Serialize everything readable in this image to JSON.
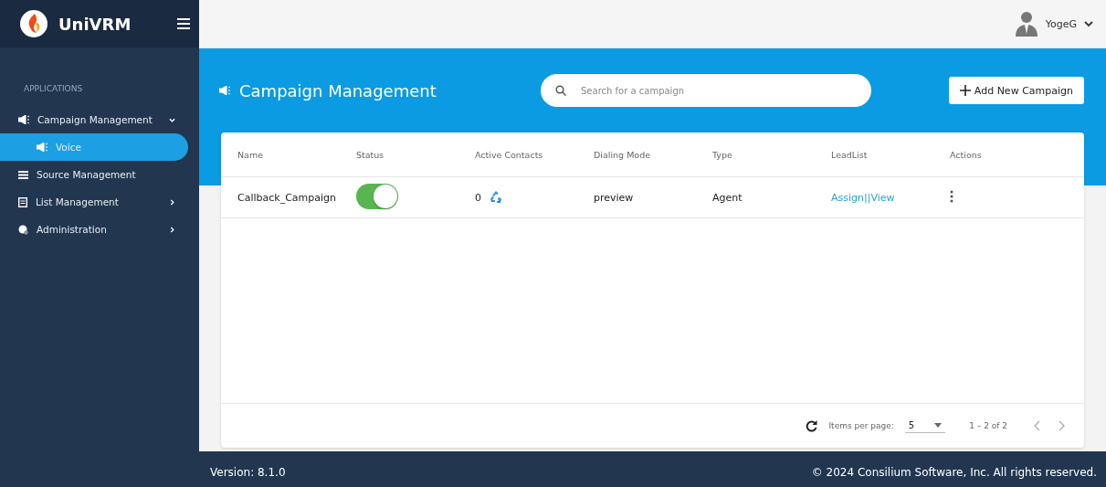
{
  "app": {
    "name": "UniVRM"
  },
  "user": {
    "name": "YogeG"
  },
  "sidebar": {
    "section": "APPLICATIONS",
    "items": [
      {
        "label": "Campaign Management",
        "expanded": true,
        "selected": false,
        "children": [
          {
            "label": "Voice",
            "selected": true
          }
        ]
      },
      {
        "label": "Source Management",
        "selected": false
      },
      {
        "label": "List Management",
        "expanded": false,
        "selected": false
      },
      {
        "label": "Administration",
        "expanded": false,
        "selected": false
      }
    ]
  },
  "page": {
    "title": "Campaign Management",
    "search": {
      "placeholder": "Search for a campaign"
    },
    "add_button": "Add New Campaign"
  },
  "table": {
    "columns": [
      "Name",
      "Status",
      "Active Contacts",
      "Dialing Mode",
      "Type",
      "LeadList",
      "Actions"
    ],
    "rows": [
      {
        "name": "Callback_Campaign",
        "on": true,
        "active_contacts": "0",
        "dialing_mode": "preview",
        "type": "Agent",
        "assign": "Assign",
        "separator": "||",
        "view": "View"
      }
    ]
  },
  "pagination": {
    "items_label": "Items per page:",
    "page_size": "5",
    "range": "1 – 2 of 2"
  },
  "footer": {
    "version": "Version: 8.1.0",
    "copyright": "© 2024 Consilium Software, Inc. All rights reserved."
  }
}
